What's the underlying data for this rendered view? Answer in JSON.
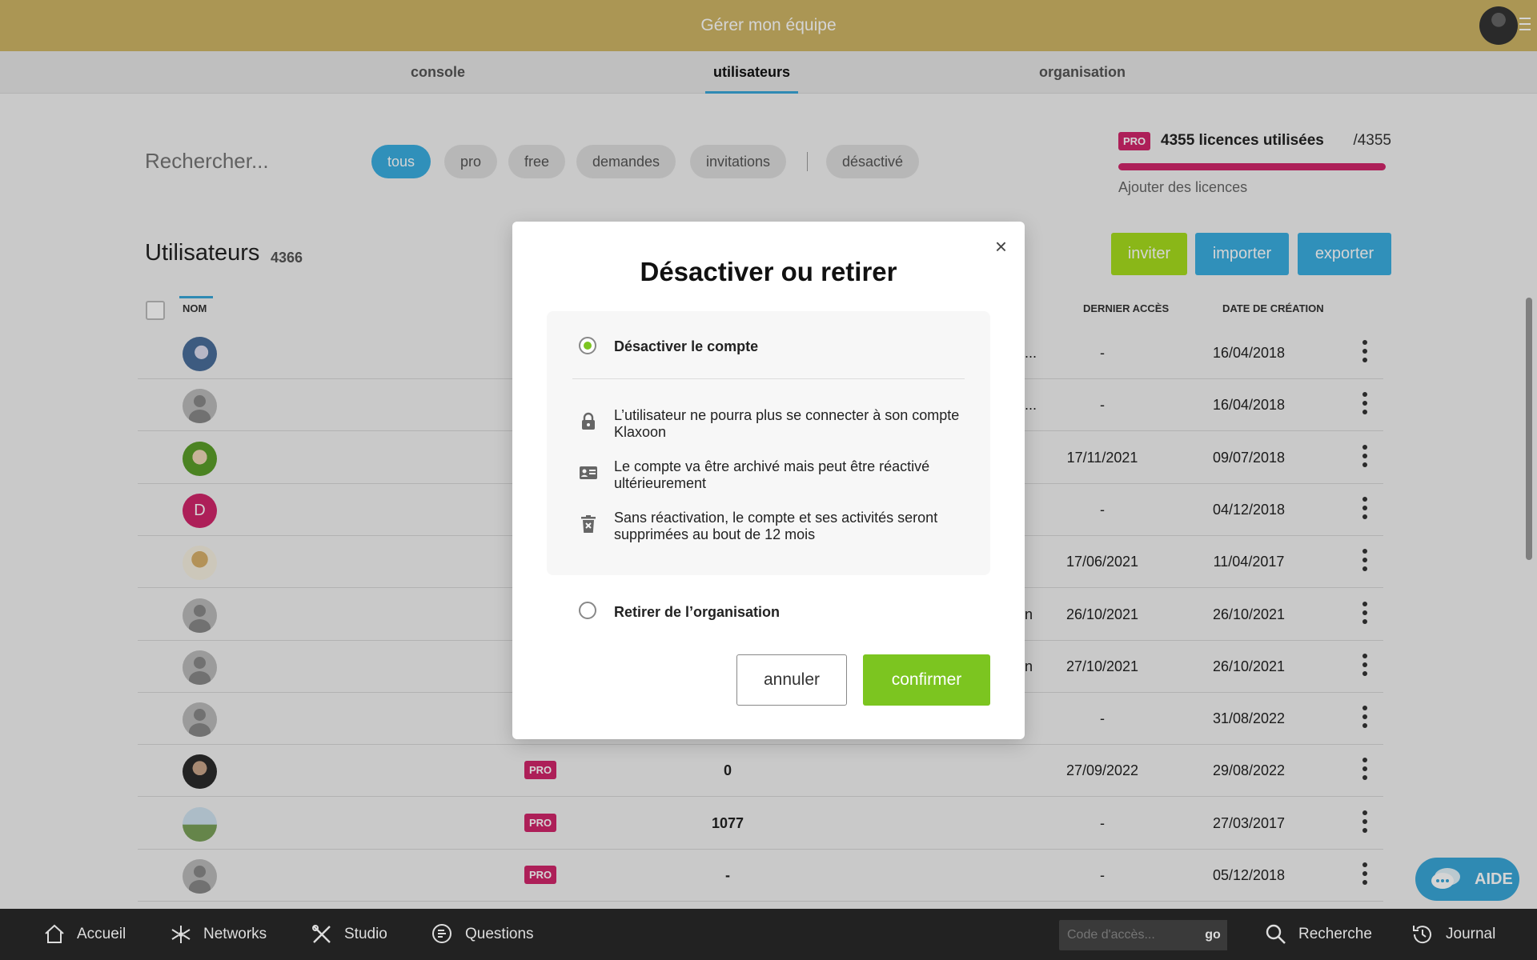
{
  "header": {
    "title": "Gérer mon équipe"
  },
  "tabs": [
    {
      "label": "console"
    },
    {
      "label": "utilisateurs"
    },
    {
      "label": "organisation"
    }
  ],
  "search": {
    "placeholder": "Rechercher..."
  },
  "filters": [
    {
      "label": "tous"
    },
    {
      "label": "pro"
    },
    {
      "label": "free"
    },
    {
      "label": "demandes"
    },
    {
      "label": "invitations"
    },
    {
      "label": "désactivé"
    }
  ],
  "licenses": {
    "badge": "PRO",
    "used_label": "4355 licences utilisées",
    "total": "/4355",
    "fill_fraction": 1.0,
    "add_label": "Ajouter des licences",
    "bar_color": "#d0266a"
  },
  "users": {
    "title": "Utilisateurs",
    "count": "4366",
    "buttons": {
      "invite": "inviter",
      "import": "importer",
      "export": "exporter"
    }
  },
  "table": {
    "columns": {
      "name": "NOM",
      "last_access": "DERNIER ACCÈS",
      "created": "DATE DE CRÉATION"
    },
    "rows": [
      {
        "avatar": "bird-photo-avatar",
        "pro": "",
        "num": "",
        "trunc": "...",
        "last_access": "-",
        "created": "16/04/2018"
      },
      {
        "avatar": "default-avatar",
        "pro": "",
        "num": "",
        "trunc": "...",
        "last_access": "-",
        "created": "16/04/2018"
      },
      {
        "avatar": "cartoon-avatar",
        "pro": "",
        "num": "",
        "trunc": "",
        "last_access": "17/11/2021",
        "created": "09/07/2018"
      },
      {
        "avatar": "letter-avatar",
        "letter": "D",
        "pro": "",
        "num": "",
        "trunc": "",
        "last_access": "-",
        "created": "04/12/2018"
      },
      {
        "avatar": "character-avatar",
        "pro": "",
        "num": "",
        "trunc": "",
        "last_access": "17/06/2021",
        "created": "11/04/2017"
      },
      {
        "avatar": "default-avatar",
        "pro": "",
        "num": "",
        "trunc": "n",
        "last_access": "26/10/2021",
        "created": "26/10/2021"
      },
      {
        "avatar": "default-avatar",
        "pro": "",
        "num": "",
        "trunc": "n",
        "last_access": "27/10/2021",
        "created": "26/10/2021"
      },
      {
        "avatar": "default-avatar",
        "pro": "",
        "num": "",
        "trunc": "",
        "last_access": "-",
        "created": "31/08/2022"
      },
      {
        "avatar": "person-photo-avatar",
        "pro": "PRO",
        "num": "0",
        "trunc": "",
        "last_access": "27/09/2022",
        "created": "29/08/2022"
      },
      {
        "avatar": "landscape-photo-avatar",
        "pro": "PRO",
        "num": "1077",
        "trunc": "",
        "last_access": "-",
        "created": "27/03/2017"
      },
      {
        "avatar": "default-avatar",
        "pro": "PRO",
        "num": "-",
        "trunc": "",
        "last_access": "-",
        "created": "05/12/2018"
      }
    ]
  },
  "modal": {
    "title": "Désactiver ou retirer",
    "close": "×",
    "option_deactivate": "Désactiver le compte",
    "info": [
      {
        "icon": "lock-icon",
        "text": "L’utilisateur ne pourra plus se connecter à son compte Klaxoon"
      },
      {
        "icon": "id-card-icon",
        "text": "Le compte va être archivé mais peut être réactivé ultérieurement"
      },
      {
        "icon": "trash-icon",
        "text": "Sans réactivation, le compte et ses activités seront supprimées au bout de 12 mois"
      }
    ],
    "option_remove": "Retirer de l’organisation",
    "cancel": "annuler",
    "confirm": "confirmer"
  },
  "help": {
    "label": "AIDE"
  },
  "bottom_nav": {
    "home": "Accueil",
    "networks": "Networks",
    "studio": "Studio",
    "questions": "Questions",
    "code_placeholder": "Code d'accès...",
    "go": "go",
    "search": "Recherche",
    "journal": "Journal"
  },
  "colors": {
    "header": "#ceb566",
    "accent_blue": "#3aaee0",
    "pro_pink": "#d0266a",
    "confirm_green": "#7cc520",
    "invite_green": "#a6dc1e"
  }
}
